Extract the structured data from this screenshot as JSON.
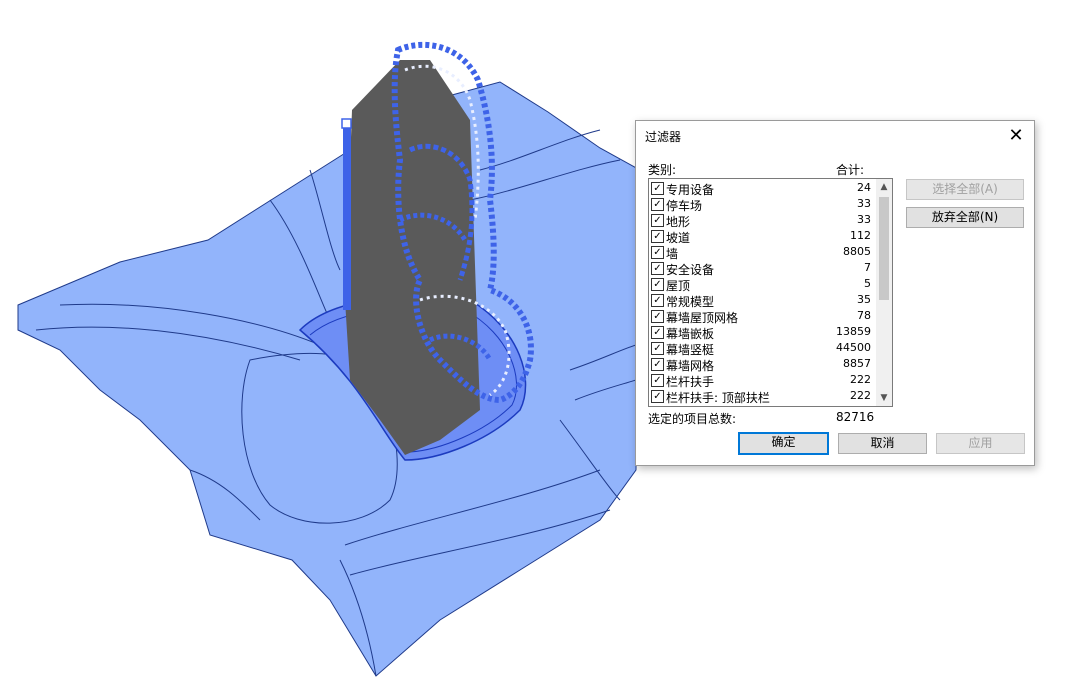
{
  "dialog": {
    "title": "过滤器",
    "close_glyph": "✕",
    "header_category": "类别:",
    "header_count": "合计:",
    "items": [
      {
        "label": "专用设备",
        "count": "24",
        "checked": true
      },
      {
        "label": "停车场",
        "count": "33",
        "checked": true
      },
      {
        "label": "地形",
        "count": "33",
        "checked": true
      },
      {
        "label": "坡道",
        "count": "112",
        "checked": true
      },
      {
        "label": "墙",
        "count": "8805",
        "checked": true
      },
      {
        "label": "安全设备",
        "count": "7",
        "checked": true
      },
      {
        "label": "屋顶",
        "count": "5",
        "checked": true
      },
      {
        "label": "常规模型",
        "count": "35",
        "checked": true
      },
      {
        "label": "幕墙屋顶网格",
        "count": "78",
        "checked": true
      },
      {
        "label": "幕墙嵌板",
        "count": "13859",
        "checked": true
      },
      {
        "label": "幕墙竖梃",
        "count": "44500",
        "checked": true
      },
      {
        "label": "幕墙网格",
        "count": "8857",
        "checked": true
      },
      {
        "label": "栏杆扶手",
        "count": "222",
        "checked": true
      },
      {
        "label": "栏杆扶手: 顶部扶栏",
        "count": "222",
        "checked": true
      }
    ],
    "select_all": "选择全部(A)",
    "deselect_all": "放弃全部(N)",
    "total_label": "选定的项目总数:",
    "total_value": "82716",
    "ok": "确定",
    "cancel": "取消",
    "apply": "应用"
  },
  "colors": {
    "site": "#92b4fb",
    "site_line": "#1f3a8a",
    "building": "#5a5a5a",
    "curtain": "#3e63e8",
    "accent": "#0078d7"
  }
}
